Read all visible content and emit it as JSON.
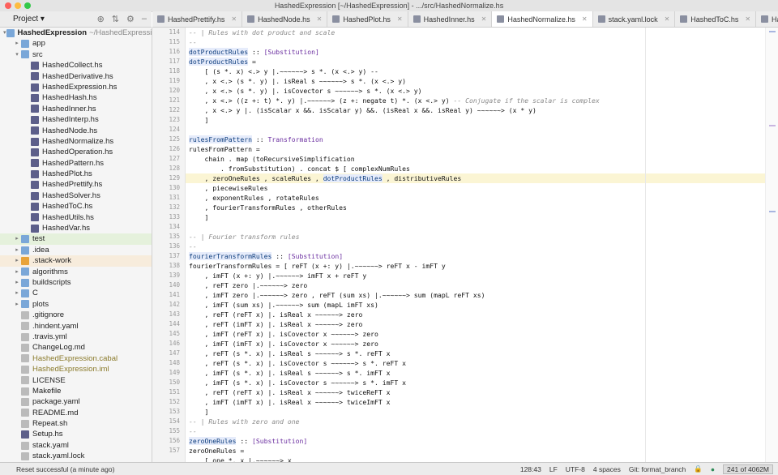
{
  "window": {
    "title": "HashedExpression [~/HashedExpression] - .../src/HashedNormalize.hs"
  },
  "project": {
    "label": "Project",
    "dropdown": "▾"
  },
  "tabs": [
    {
      "label": "HashedPrettify.hs",
      "active": false
    },
    {
      "label": "HashedNode.hs",
      "active": false
    },
    {
      "label": "HashedPlot.hs",
      "active": false
    },
    {
      "label": "HashedInner.hs",
      "active": false
    },
    {
      "label": "HashedNormalize.hs",
      "active": true
    },
    {
      "label": "stack.yaml.lock",
      "active": false
    },
    {
      "label": "HashedToC.hs",
      "active": false
    },
    {
      "label": "HashedPattern.hs",
      "active": false
    }
  ],
  "tree": [
    {
      "label": "HashedExpression",
      "extra": "~/HashedExpression",
      "depth": 0,
      "icon": "folder",
      "arrow": "▾",
      "bold": true
    },
    {
      "label": "app",
      "depth": 1,
      "icon": "folder",
      "arrow": "▸"
    },
    {
      "label": "src",
      "depth": 1,
      "icon": "folder",
      "arrow": "▾"
    },
    {
      "label": "HashedCollect.hs",
      "depth": 2,
      "icon": "hs"
    },
    {
      "label": "HashedDerivative.hs",
      "depth": 2,
      "icon": "hs"
    },
    {
      "label": "HashedExpression.hs",
      "depth": 2,
      "icon": "hs"
    },
    {
      "label": "HashedHash.hs",
      "depth": 2,
      "icon": "hs"
    },
    {
      "label": "HashedInner.hs",
      "depth": 2,
      "icon": "hs"
    },
    {
      "label": "HashedInterp.hs",
      "depth": 2,
      "icon": "hs"
    },
    {
      "label": "HashedNode.hs",
      "depth": 2,
      "icon": "hs"
    },
    {
      "label": "HashedNormalize.hs",
      "depth": 2,
      "icon": "hs"
    },
    {
      "label": "HashedOperation.hs",
      "depth": 2,
      "icon": "hs"
    },
    {
      "label": "HashedPattern.hs",
      "depth": 2,
      "icon": "hs"
    },
    {
      "label": "HashedPlot.hs",
      "depth": 2,
      "icon": "hs"
    },
    {
      "label": "HashedPrettify.hs",
      "depth": 2,
      "icon": "hs"
    },
    {
      "label": "HashedSolver.hs",
      "depth": 2,
      "icon": "hs"
    },
    {
      "label": "HashedToC.hs",
      "depth": 2,
      "icon": "hs"
    },
    {
      "label": "HashedUtils.hs",
      "depth": 2,
      "icon": "hs"
    },
    {
      "label": "HashedVar.hs",
      "depth": 2,
      "icon": "hs"
    },
    {
      "label": "test",
      "depth": 1,
      "icon": "folder",
      "arrow": "▸",
      "hl": "green"
    },
    {
      "label": ".idea",
      "depth": 1,
      "icon": "folder",
      "arrow": "▸"
    },
    {
      "label": ".stack-work",
      "depth": 1,
      "icon": "folder-o",
      "arrow": "▸",
      "hl": "orange"
    },
    {
      "label": "algorithms",
      "depth": 1,
      "icon": "folder",
      "arrow": "▸"
    },
    {
      "label": "buildscripts",
      "depth": 1,
      "icon": "folder",
      "arrow": "▸"
    },
    {
      "label": "C",
      "depth": 1,
      "icon": "folder",
      "arrow": "▸"
    },
    {
      "label": "plots",
      "depth": 1,
      "icon": "folder",
      "arrow": "▸"
    },
    {
      "label": ".gitignore",
      "depth": 1,
      "icon": "doc"
    },
    {
      "label": ".hindent.yaml",
      "depth": 1,
      "icon": "doc"
    },
    {
      "label": ".travis.yml",
      "depth": 1,
      "icon": "doc"
    },
    {
      "label": "ChangeLog.md",
      "depth": 1,
      "icon": "doc"
    },
    {
      "label": "HashedExpression.cabal",
      "depth": 1,
      "icon": "doc",
      "color": "#8a7a2a"
    },
    {
      "label": "HashedExpression.iml",
      "depth": 1,
      "icon": "doc",
      "color": "#8a7a2a"
    },
    {
      "label": "LICENSE",
      "depth": 1,
      "icon": "doc"
    },
    {
      "label": "Makefile",
      "depth": 1,
      "icon": "doc"
    },
    {
      "label": "package.yaml",
      "depth": 1,
      "icon": "doc"
    },
    {
      "label": "README.md",
      "depth": 1,
      "icon": "doc"
    },
    {
      "label": "Repeat.sh",
      "depth": 1,
      "icon": "doc"
    },
    {
      "label": "Setup.hs",
      "depth": 1,
      "icon": "hs"
    },
    {
      "label": "stack.yaml",
      "depth": 1,
      "icon": "doc"
    },
    {
      "label": "stack.yaml.lock",
      "depth": 1,
      "icon": "doc"
    }
  ],
  "gutter": {
    "start": 114,
    "count": 44
  },
  "code": [
    {
      "t": "-- | Rules with dot product and scale",
      "c": "cm"
    },
    {
      "t": "--",
      "c": "cm"
    },
    {
      "t": "dotProductRules :: [Substitution]",
      "c": "sig"
    },
    {
      "t": "dotProductRules =",
      "c": "def"
    },
    {
      "t": "    [ (s *. x) <.> y |.~~~~~~> s *. (x <.> y) --"
    },
    {
      "t": "    , x <.> (s *. y) |. isReal s ~~~~~~> s *. (x <.> y)"
    },
    {
      "t": "    , x <.> (s *. y) |. isCovector s ~~~~~~> s *. (x <.> y)"
    },
    {
      "t": "    , x <.> ((z +: t) *. y) |.~~~~~~> (z +: negate t) *. (x <.> y) -- Conjugate if the scalar is complex"
    },
    {
      "t": "    , x <.> y |. (isScalar x &&. isScalar y) &&. (isReal x &&. isReal y) ~~~~~~> (x * y)"
    },
    {
      "t": "    ]"
    },
    {
      "t": ""
    },
    {
      "t": "rulesFromPattern :: Transformation",
      "c": "sig"
    },
    {
      "t": "rulesFromPattern ="
    },
    {
      "t": "    chain . map (toRecursiveSimplification"
    },
    {
      "t": "        . fromSubstitution) . concat $ [ complexNumRules"
    },
    {
      "t": "    , zeroOneRules , scaleRules , dotProductRules , distributiveRules",
      "cur": true
    },
    {
      "t": "    , piecewiseRules"
    },
    {
      "t": "    , exponentRules , rotateRules"
    },
    {
      "t": "    , fourierTransformRules , otherRules"
    },
    {
      "t": "    ]"
    },
    {
      "t": ""
    },
    {
      "t": "-- | Fourier transform rules",
      "c": "cm"
    },
    {
      "t": "--",
      "c": "cm"
    },
    {
      "t": "fourierTransformRules :: [Substitution]",
      "c": "sig"
    },
    {
      "t": "fourierTransformRules = [ reFT (x +: y) |.~~~~~~> reFT x - imFT y"
    },
    {
      "t": "    , imFT (x +: y) |.~~~~~~> imFT x + reFT y"
    },
    {
      "t": "    , reFT zero |.~~~~~~> zero"
    },
    {
      "t": "    , imFT zero |.~~~~~~> zero , reFT (sum xs) |.~~~~~~> sum (mapL reFT xs)"
    },
    {
      "t": "    , imFT (sum xs) |.~~~~~~> sum (mapL imFT xs)"
    },
    {
      "t": "    , reFT (reFT x) |. isReal x ~~~~~~> zero"
    },
    {
      "t": "    , reFT (imFT x) |. isReal x ~~~~~~> zero"
    },
    {
      "t": "    , imFT (reFT x) |. isCovector x ~~~~~~> zero"
    },
    {
      "t": "    , imFT (imFT x) |. isCovector x ~~~~~~> zero"
    },
    {
      "t": "    , reFT (s *. x) |. isReal s ~~~~~~> s *. reFT x"
    },
    {
      "t": "    , reFT (s *. x) |. isCovector s ~~~~~~> s *. reFT x"
    },
    {
      "t": "    , imFT (s *. x) |. isReal s ~~~~~~> s *. imFT x"
    },
    {
      "t": "    , imFT (s *. x) |. isCovector s ~~~~~~> s *. imFT x"
    },
    {
      "t": "    , reFT (reFT x) |. isReal x ~~~~~~> twiceReFT x"
    },
    {
      "t": "    , imFT (imFT x) |. isReal x ~~~~~~> twiceImFT x"
    },
    {
      "t": "    ]"
    },
    {
      "t": "-- | Rules with zero and one",
      "c": "cm"
    },
    {
      "t": "--",
      "c": "cm"
    },
    {
      "t": "zeroOneRules :: [Substitution]",
      "c": "sig"
    },
    {
      "t": "zeroOneRules ="
    },
    {
      "t": "    [ one *. x |.~~~~~~> x"
    }
  ],
  "status": {
    "message": "Reset successful (a minute ago)",
    "position": "128:43",
    "line_sep": "LF",
    "encoding": "UTF-8",
    "indent": "4 spaces",
    "git": "Git: format_branch",
    "memory": "241 of 4062M"
  },
  "colors": {
    "accent": "#6e9ee0",
    "current_line": "#fbf5d4",
    "keyword": "#1a1aa6",
    "type": "#6b2fa0",
    "comment": "#8a8a8a"
  }
}
